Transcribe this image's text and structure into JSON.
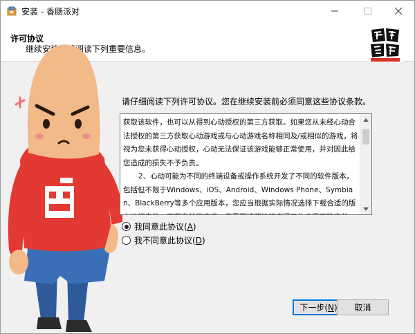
{
  "window": {
    "title": "安装 - 香肠派对"
  },
  "header": {
    "title": "许可协议",
    "subtitle": "继续安装前请阅读下列重要信息。",
    "logo_icon": "sausage-man-logo-icon"
  },
  "content": {
    "instruction": "请仔细阅读下列许可协议。您在继续安装前必须同意这些协议条款。",
    "license_lines": [
      "获取该软件，也可以从得到心动授权的第三方获取。如果您从未经心动合法授权的第三方获取心动游戏或与心动游戏名称相同及/或相似的游戏，将视为您未获得心动授权，心动无法保证该游戏能够正常使用，并对因此给您造成的损失不予负责。",
      "2、心动可能为不同的终端设备或操作系统开发了不同的软件版本，包括但不限于Windows、iOS、Android、Windows Phone、Symbian、BlackBerry等多个应用版本，您应当根据实际情况选择下载合适的版本进行安装，下载安装程序后，您需要按照该程序提示的步骤正确安装。"
    ]
  },
  "options": {
    "agree_label": "我同意此协议(",
    "agree_key": "A",
    "agree_tail": ")",
    "disagree_label": "我不同意此协议(",
    "disagree_key": "D",
    "disagree_tail": ")",
    "selected": "agree"
  },
  "buttons": {
    "next_label": "下一步(",
    "next_key": "N",
    "next_tail": ")",
    "cancel_label": "取消"
  },
  "colors": {
    "accent": "#0078d7",
    "mascot_shirt": "#e23a33",
    "mascot_skin": "#f2b989"
  }
}
